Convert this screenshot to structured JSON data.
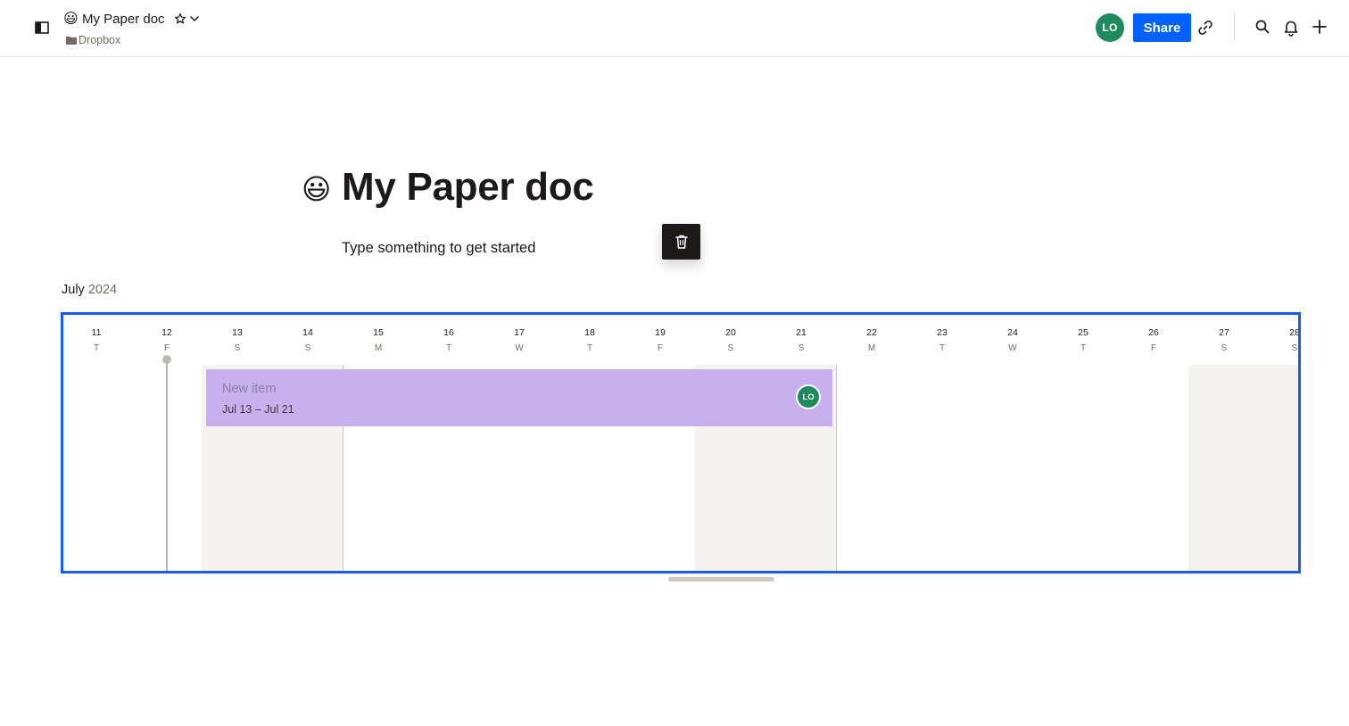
{
  "header": {
    "doc_emoji": "😃",
    "doc_title": "My Paper doc",
    "breadcrumb_folder": "Dropbox",
    "avatar_initials": "LO",
    "share_label": "Share"
  },
  "doc": {
    "emoji": "😃",
    "title": "My Paper doc",
    "placeholder": "Type something to get started"
  },
  "timeline": {
    "month": "July",
    "year": "2024",
    "days": [
      {
        "num": "11",
        "wd": "T"
      },
      {
        "num": "12",
        "wd": "F"
      },
      {
        "num": "13",
        "wd": "S"
      },
      {
        "num": "14",
        "wd": "S"
      },
      {
        "num": "15",
        "wd": "M"
      },
      {
        "num": "16",
        "wd": "T"
      },
      {
        "num": "17",
        "wd": "W"
      },
      {
        "num": "18",
        "wd": "T"
      },
      {
        "num": "19",
        "wd": "F"
      },
      {
        "num": "20",
        "wd": "S"
      },
      {
        "num": "21",
        "wd": "S"
      },
      {
        "num": "22",
        "wd": "M"
      },
      {
        "num": "23",
        "wd": "T"
      },
      {
        "num": "24",
        "wd": "W"
      },
      {
        "num": "25",
        "wd": "T"
      },
      {
        "num": "26",
        "wd": "F"
      },
      {
        "num": "27",
        "wd": "S"
      },
      {
        "num": "28",
        "wd": "S"
      }
    ],
    "item": {
      "title": "New item",
      "dates": "Jul 13 – Jul 21",
      "avatar": "LO",
      "color": "#c8b0ee"
    }
  },
  "colors": {
    "accent": "#0061fe",
    "avatar": "#1f8a5b",
    "selection": "#1a5cf0"
  }
}
